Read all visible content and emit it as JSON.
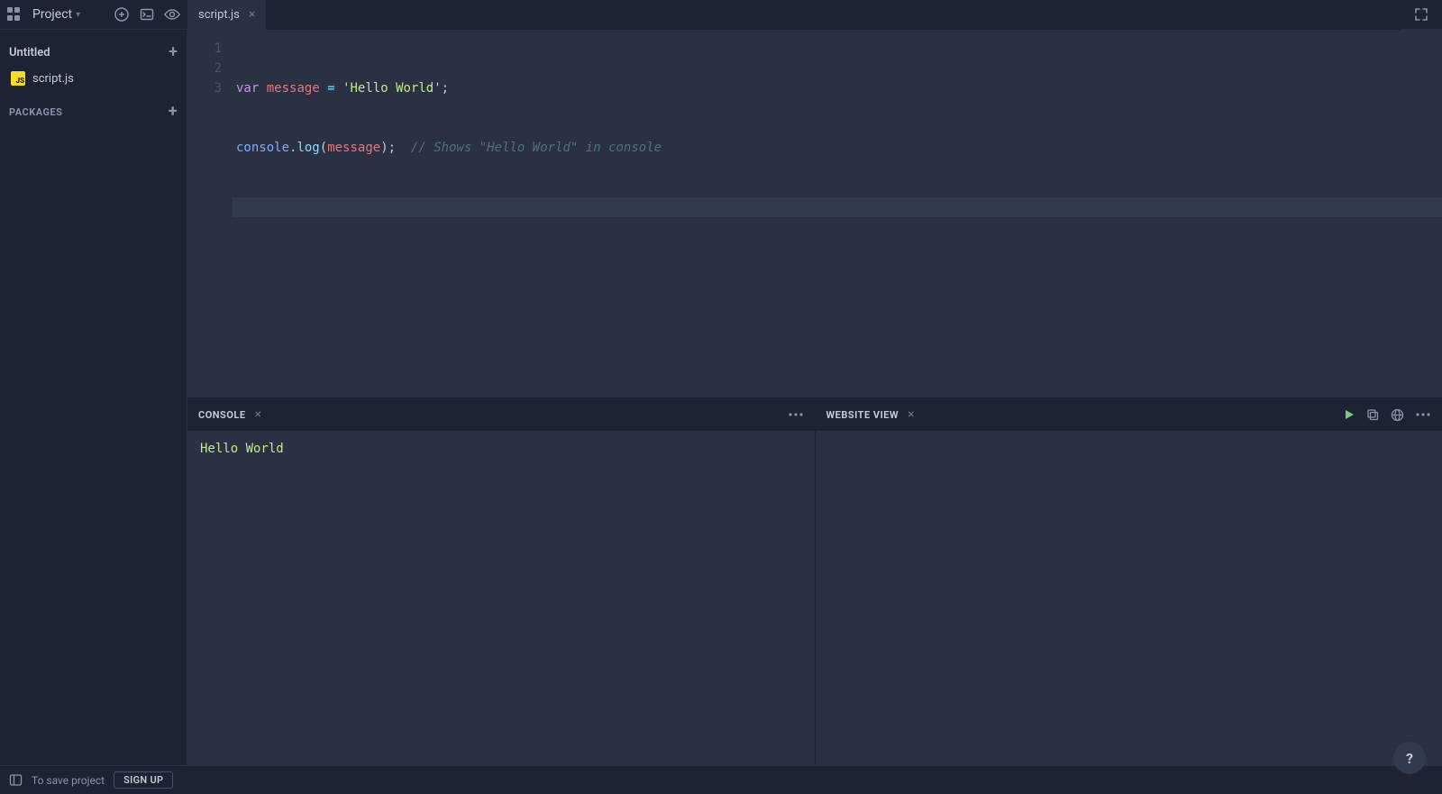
{
  "topbar": {
    "project_label": "Project",
    "active_tab": "script.js"
  },
  "sidebar": {
    "project_title": "Untitled",
    "files": [
      {
        "name": "script.js",
        "type": "js"
      }
    ],
    "packages_label": "PACKAGES"
  },
  "editor": {
    "line_numbers": [
      "1",
      "2",
      "3"
    ],
    "code": {
      "line1": {
        "kw": "var",
        "ident": "message",
        "op": "=",
        "str": "'Hello World'",
        "end": ";"
      },
      "line2": {
        "obj": "console",
        "dot": ".",
        "method": "log",
        "open": "(",
        "arg": "message",
        "close": ");",
        "comment": "// Shows \"Hello World\" in console"
      }
    }
  },
  "panels": {
    "console": {
      "title": "CONSOLE",
      "output": "Hello World"
    },
    "preview": {
      "title": "WEBSITE VIEW"
    }
  },
  "statusbar": {
    "save_hint": "To save project",
    "signup_label": "SIGN UP"
  },
  "help": {
    "label": "?"
  }
}
